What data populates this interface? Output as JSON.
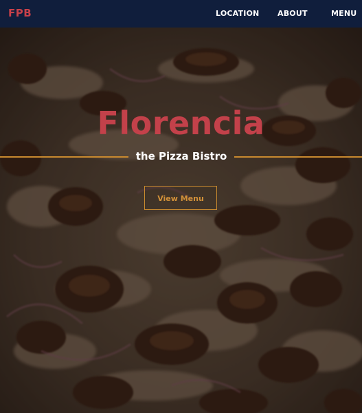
{
  "navbar": {
    "brand": "FPB",
    "links": [
      {
        "label": "LOCATION"
      },
      {
        "label": "ABOUT"
      },
      {
        "label": "MENU"
      }
    ]
  },
  "hero": {
    "title": "Florencia",
    "subtitle": "the Pizza Bistro",
    "button_label": "View Menu"
  },
  "colors": {
    "navbar_bg": "#101e3c",
    "brand": "#c8414a",
    "title": "#c3414a",
    "accent_gold": "#c98a2f"
  }
}
